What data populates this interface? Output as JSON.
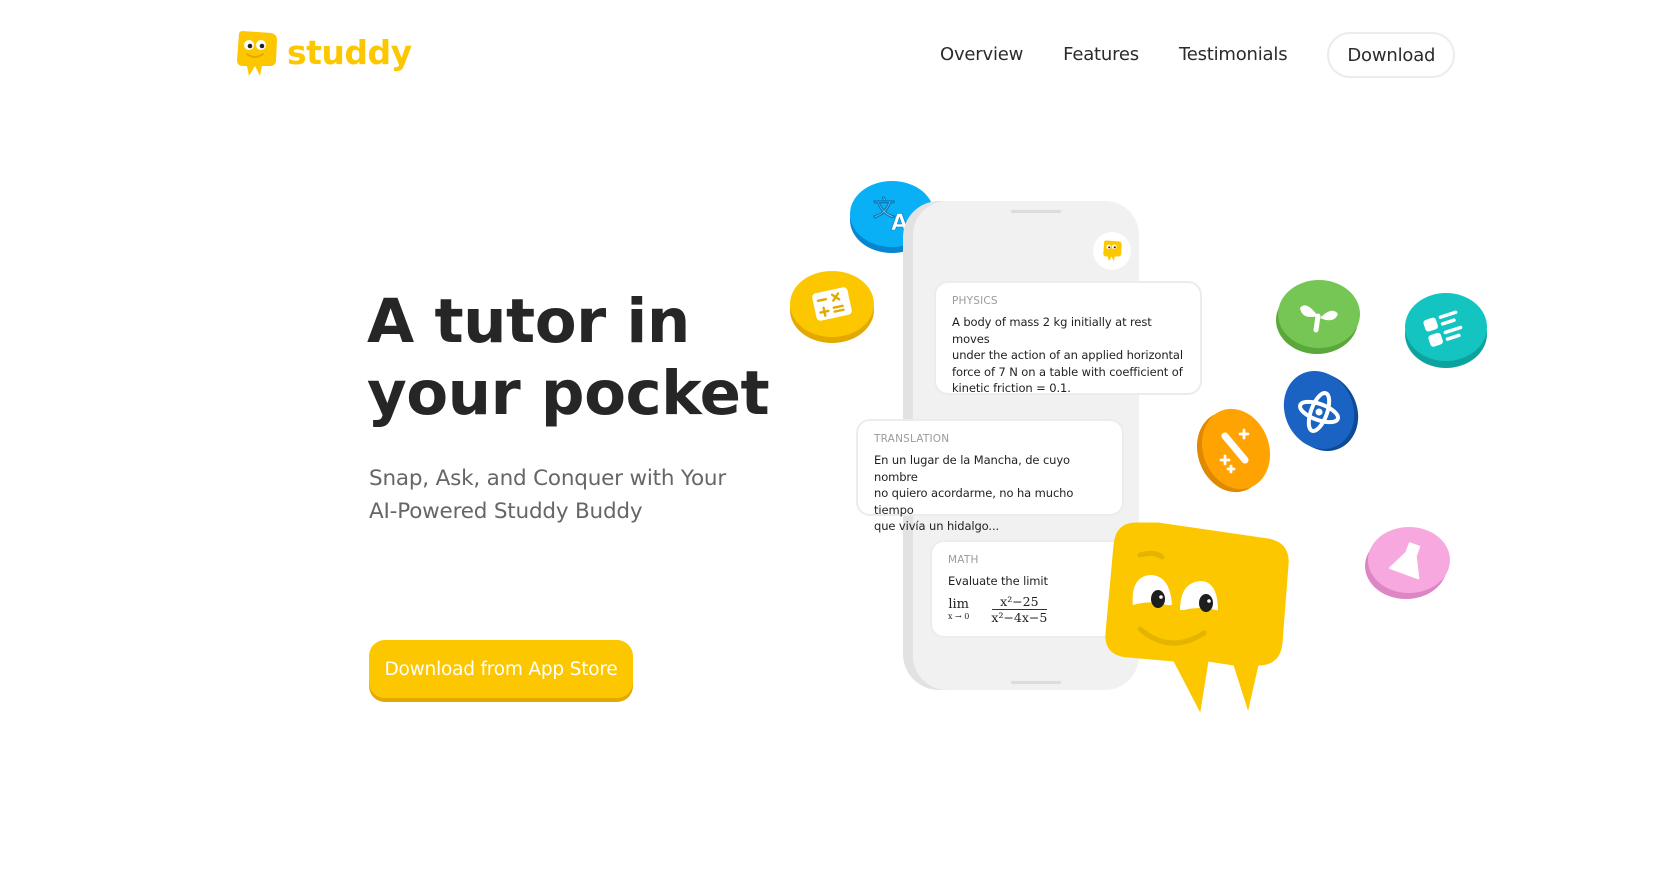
{
  "brand": {
    "name": "studdy",
    "color": "#fdc700",
    "logo_icon": "speech-bubble-mascot-icon"
  },
  "nav": {
    "links": [
      {
        "label": "Overview"
      },
      {
        "label": "Features"
      },
      {
        "label": "Testimonials"
      }
    ],
    "download_button": "Download"
  },
  "hero": {
    "headline_line1": "A tutor in",
    "headline_line2": "your pocket",
    "subtitle_line1": "Snap, Ask, and Conquer with Your",
    "subtitle_line2": "AI-Powered Studdy Buddy",
    "cta_label": "Download from App Store"
  },
  "phone": {
    "cards": [
      {
        "tag": "PHYSICS",
        "lines": [
          "A body of mass 2 kg initially at rest moves",
          "under the action of an applied horizontal",
          "force of 7 N on a table with coefficient of",
          "kinetic friction = 0.1."
        ]
      },
      {
        "tag": "TRANSLATION",
        "lines": [
          "En un lugar de la Mancha, de cuyo nombre",
          "no quiero acordarme, no ha mucho tiempo",
          "que vivía un hidalgo..."
        ]
      },
      {
        "tag": "MATH",
        "prompt": "Evaluate the limit",
        "lim": "lim",
        "lim_sub": "x → 0",
        "numerator": "x²−25",
        "denominator": "x²−4x−5"
      }
    ]
  },
  "subject_coins": [
    {
      "subject": "translation",
      "icon": "translate-icon",
      "color": "#0ab0f5"
    },
    {
      "subject": "math",
      "icon": "calculator-icon",
      "color": "#fdc700"
    },
    {
      "subject": "biology",
      "icon": "sprout-icon",
      "color": "#76c655"
    },
    {
      "subject": "reading",
      "icon": "checklist-icon",
      "color": "#14c4c0"
    },
    {
      "subject": "physics",
      "icon": "atom-icon",
      "color": "#1a63c2"
    },
    {
      "subject": "art",
      "icon": "magic-wand-icon",
      "color": "#ffa302"
    },
    {
      "subject": "chemistry",
      "icon": "flask-icon",
      "color": "#f7a9df"
    }
  ],
  "colors": {
    "accent": "#fdc700",
    "accent_shadow": "#e3a900",
    "text_dark": "#262626",
    "text_muted": "#666666"
  }
}
